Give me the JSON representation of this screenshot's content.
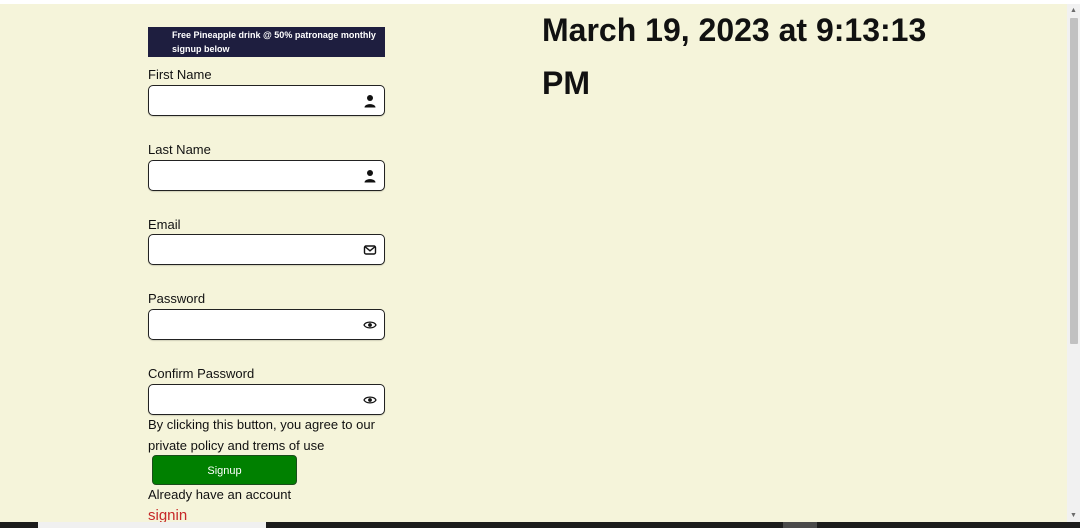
{
  "promo": {
    "text": "Free Pineapple drink @ 50% patronage monthly signup below"
  },
  "form": {
    "fields": [
      {
        "label": "First Name",
        "icon": "user-icon",
        "value": ""
      },
      {
        "label": "Last Name",
        "icon": "user-icon",
        "value": ""
      },
      {
        "label": "Email",
        "icon": "envelope-icon",
        "value": ""
      },
      {
        "label": "Password",
        "icon": "eye-icon",
        "value": ""
      },
      {
        "label": "Confirm Password",
        "icon": "eye-icon",
        "value": ""
      }
    ],
    "agreement": "By clicking this button, you agree to our private policy and trems of use",
    "signup_label": "Signup",
    "already_text": "Already have an account",
    "signin_label": "signin"
  },
  "clock": {
    "text": "March 19, 2023 at 9:13:13 PM"
  },
  "colors": {
    "background": "#f5f4da",
    "promo_bg": "#1e1e3f",
    "signup_bg": "#008000",
    "signin_link": "#c62828"
  }
}
